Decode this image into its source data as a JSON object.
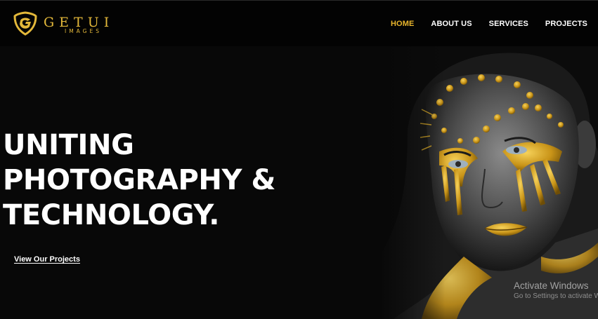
{
  "brand": {
    "name": "GETUI",
    "subtitle": "IMAGES",
    "logo_icon": "shield-emblem-icon",
    "accent_color": "#e3b83a"
  },
  "nav": {
    "items": [
      {
        "label": "HOME",
        "active": true
      },
      {
        "label": "ABOUT US",
        "active": false
      },
      {
        "label": "SERVICES",
        "active": false
      },
      {
        "label": "PROJECTS",
        "active": false
      }
    ],
    "active_color": "#e8b52c"
  },
  "hero": {
    "headline_lines": [
      "UNITING",
      "PHOTOGRAPHY &",
      "TECHNOLOGY."
    ],
    "cta_label": "View Our Projects",
    "image": "portrait-gold-face-paint"
  },
  "watermark": {
    "title": "Activate Windows",
    "subtitle": "Go to Settings to activate Windows."
  }
}
